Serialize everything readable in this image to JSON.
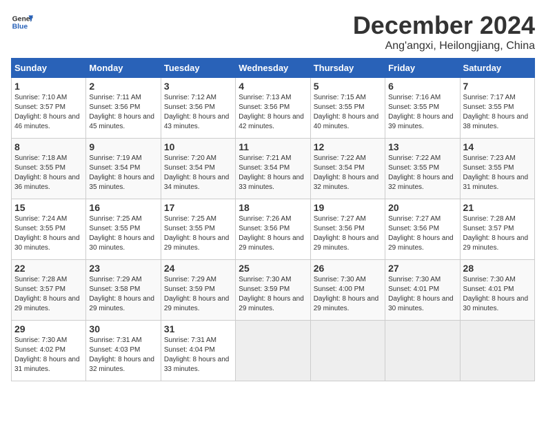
{
  "header": {
    "logo_line1": "General",
    "logo_line2": "Blue",
    "month": "December 2024",
    "location": "Ang'angxi, Heilongjiang, China"
  },
  "weekdays": [
    "Sunday",
    "Monday",
    "Tuesday",
    "Wednesday",
    "Thursday",
    "Friday",
    "Saturday"
  ],
  "weeks": [
    [
      {
        "day": "1",
        "sunrise": "Sunrise: 7:10 AM",
        "sunset": "Sunset: 3:57 PM",
        "daylight": "Daylight: 8 hours and 46 minutes."
      },
      {
        "day": "2",
        "sunrise": "Sunrise: 7:11 AM",
        "sunset": "Sunset: 3:56 PM",
        "daylight": "Daylight: 8 hours and 45 minutes."
      },
      {
        "day": "3",
        "sunrise": "Sunrise: 7:12 AM",
        "sunset": "Sunset: 3:56 PM",
        "daylight": "Daylight: 8 hours and 43 minutes."
      },
      {
        "day": "4",
        "sunrise": "Sunrise: 7:13 AM",
        "sunset": "Sunset: 3:56 PM",
        "daylight": "Daylight: 8 hours and 42 minutes."
      },
      {
        "day": "5",
        "sunrise": "Sunrise: 7:15 AM",
        "sunset": "Sunset: 3:55 PM",
        "daylight": "Daylight: 8 hours and 40 minutes."
      },
      {
        "day": "6",
        "sunrise": "Sunrise: 7:16 AM",
        "sunset": "Sunset: 3:55 PM",
        "daylight": "Daylight: 8 hours and 39 minutes."
      },
      {
        "day": "7",
        "sunrise": "Sunrise: 7:17 AM",
        "sunset": "Sunset: 3:55 PM",
        "daylight": "Daylight: 8 hours and 38 minutes."
      }
    ],
    [
      {
        "day": "8",
        "sunrise": "Sunrise: 7:18 AM",
        "sunset": "Sunset: 3:55 PM",
        "daylight": "Daylight: 8 hours and 36 minutes."
      },
      {
        "day": "9",
        "sunrise": "Sunrise: 7:19 AM",
        "sunset": "Sunset: 3:54 PM",
        "daylight": "Daylight: 8 hours and 35 minutes."
      },
      {
        "day": "10",
        "sunrise": "Sunrise: 7:20 AM",
        "sunset": "Sunset: 3:54 PM",
        "daylight": "Daylight: 8 hours and 34 minutes."
      },
      {
        "day": "11",
        "sunrise": "Sunrise: 7:21 AM",
        "sunset": "Sunset: 3:54 PM",
        "daylight": "Daylight: 8 hours and 33 minutes."
      },
      {
        "day": "12",
        "sunrise": "Sunrise: 7:22 AM",
        "sunset": "Sunset: 3:54 PM",
        "daylight": "Daylight: 8 hours and 32 minutes."
      },
      {
        "day": "13",
        "sunrise": "Sunrise: 7:22 AM",
        "sunset": "Sunset: 3:55 PM",
        "daylight": "Daylight: 8 hours and 32 minutes."
      },
      {
        "day": "14",
        "sunrise": "Sunrise: 7:23 AM",
        "sunset": "Sunset: 3:55 PM",
        "daylight": "Daylight: 8 hours and 31 minutes."
      }
    ],
    [
      {
        "day": "15",
        "sunrise": "Sunrise: 7:24 AM",
        "sunset": "Sunset: 3:55 PM",
        "daylight": "Daylight: 8 hours and 30 minutes."
      },
      {
        "day": "16",
        "sunrise": "Sunrise: 7:25 AM",
        "sunset": "Sunset: 3:55 PM",
        "daylight": "Daylight: 8 hours and 30 minutes."
      },
      {
        "day": "17",
        "sunrise": "Sunrise: 7:25 AM",
        "sunset": "Sunset: 3:55 PM",
        "daylight": "Daylight: 8 hours and 29 minutes."
      },
      {
        "day": "18",
        "sunrise": "Sunrise: 7:26 AM",
        "sunset": "Sunset: 3:56 PM",
        "daylight": "Daylight: 8 hours and 29 minutes."
      },
      {
        "day": "19",
        "sunrise": "Sunrise: 7:27 AM",
        "sunset": "Sunset: 3:56 PM",
        "daylight": "Daylight: 8 hours and 29 minutes."
      },
      {
        "day": "20",
        "sunrise": "Sunrise: 7:27 AM",
        "sunset": "Sunset: 3:56 PM",
        "daylight": "Daylight: 8 hours and 29 minutes."
      },
      {
        "day": "21",
        "sunrise": "Sunrise: 7:28 AM",
        "sunset": "Sunset: 3:57 PM",
        "daylight": "Daylight: 8 hours and 29 minutes."
      }
    ],
    [
      {
        "day": "22",
        "sunrise": "Sunrise: 7:28 AM",
        "sunset": "Sunset: 3:57 PM",
        "daylight": "Daylight: 8 hours and 29 minutes."
      },
      {
        "day": "23",
        "sunrise": "Sunrise: 7:29 AM",
        "sunset": "Sunset: 3:58 PM",
        "daylight": "Daylight: 8 hours and 29 minutes."
      },
      {
        "day": "24",
        "sunrise": "Sunrise: 7:29 AM",
        "sunset": "Sunset: 3:59 PM",
        "daylight": "Daylight: 8 hours and 29 minutes."
      },
      {
        "day": "25",
        "sunrise": "Sunrise: 7:30 AM",
        "sunset": "Sunset: 3:59 PM",
        "daylight": "Daylight: 8 hours and 29 minutes."
      },
      {
        "day": "26",
        "sunrise": "Sunrise: 7:30 AM",
        "sunset": "Sunset: 4:00 PM",
        "daylight": "Daylight: 8 hours and 29 minutes."
      },
      {
        "day": "27",
        "sunrise": "Sunrise: 7:30 AM",
        "sunset": "Sunset: 4:01 PM",
        "daylight": "Daylight: 8 hours and 30 minutes."
      },
      {
        "day": "28",
        "sunrise": "Sunrise: 7:30 AM",
        "sunset": "Sunset: 4:01 PM",
        "daylight": "Daylight: 8 hours and 30 minutes."
      }
    ],
    [
      {
        "day": "29",
        "sunrise": "Sunrise: 7:30 AM",
        "sunset": "Sunset: 4:02 PM",
        "daylight": "Daylight: 8 hours and 31 minutes."
      },
      {
        "day": "30",
        "sunrise": "Sunrise: 7:31 AM",
        "sunset": "Sunset: 4:03 PM",
        "daylight": "Daylight: 8 hours and 32 minutes."
      },
      {
        "day": "31",
        "sunrise": "Sunrise: 7:31 AM",
        "sunset": "Sunset: 4:04 PM",
        "daylight": "Daylight: 8 hours and 33 minutes."
      },
      null,
      null,
      null,
      null
    ]
  ]
}
